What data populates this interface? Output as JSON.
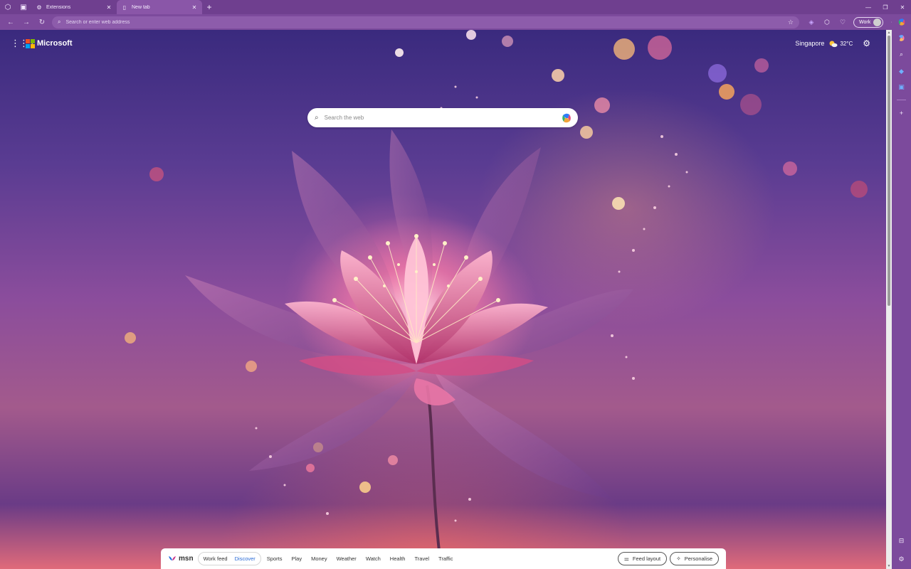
{
  "tabs": [
    {
      "label": "Extensions",
      "icon": "puzzle-icon",
      "active": false
    },
    {
      "label": "New tab",
      "icon": "page-icon",
      "active": true
    }
  ],
  "address_bar": {
    "placeholder": "Search or enter web address"
  },
  "profile": {
    "label": "Work"
  },
  "brand": {
    "name": "Microsoft",
    "colors": [
      "#f25022",
      "#7fba00",
      "#00a4ef",
      "#ffb900"
    ]
  },
  "weather": {
    "city": "Singapore",
    "temperature": "32°C",
    "icon": "partly-sunny-icon"
  },
  "search": {
    "placeholder": "Search the web"
  },
  "feed": {
    "brand": "msn",
    "toggle": [
      {
        "label": "Work feed",
        "selected": false
      },
      {
        "label": "Discover",
        "selected": true
      }
    ],
    "links": [
      "Sports",
      "Play",
      "Money",
      "Weather",
      "Watch",
      "Health",
      "Travel",
      "Traffic"
    ],
    "buttons": [
      {
        "label": "Feed layout",
        "icon": "sliders-icon"
      },
      {
        "label": "Personalise",
        "icon": "sparkle-icon"
      }
    ]
  },
  "theme": {
    "accent": "#7c4a9c",
    "link_selected": "#2a6bd6"
  }
}
